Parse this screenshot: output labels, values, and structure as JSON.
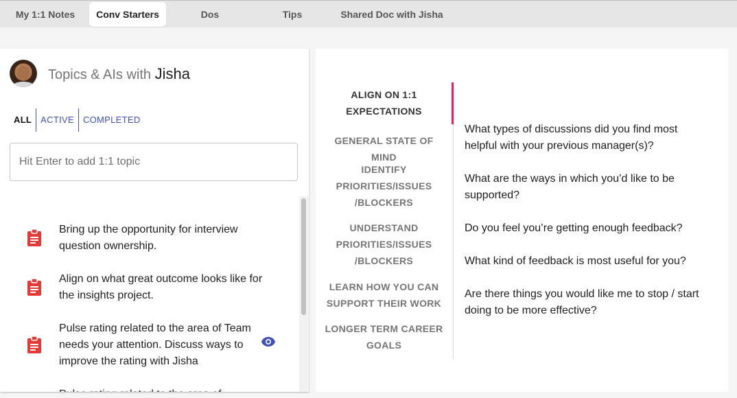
{
  "tabs": [
    {
      "label": "My 1:1 Notes",
      "active": false
    },
    {
      "label": "Conv Starters",
      "active": true
    },
    {
      "label": "Dos",
      "active": false
    },
    {
      "label": "Tips",
      "active": false
    },
    {
      "label": "Shared Doc with Jisha",
      "active": false
    }
  ],
  "left_panel": {
    "title_prefix": "Topics & AIs with",
    "person_name": "Jisha",
    "filters": [
      "ALL",
      "ACTIVE",
      "COMPLETED"
    ],
    "input_placeholder": "Hit Enter to add 1:1 topic",
    "topics": [
      {
        "text": "Bring up the opportunity for interview question ownership.",
        "icon": "clipboard-icon"
      },
      {
        "text": "Align on what great outcome looks like for the insights project.",
        "icon": "clipboard-icon"
      },
      {
        "text": "Pulse rating related to the area of Team needs your attention. Discuss ways to improve the rating with Jisha",
        "icon": "clipboard-icon",
        "has_eye": true
      },
      {
        "text": "Pulse rating related to the area of",
        "icon": "clipboard-icon"
      }
    ]
  },
  "right_panel": {
    "menu": [
      {
        "label": "ALIGN ON 1:1 EXPECTATIONS",
        "active": true
      },
      {
        "label": "GENERAL STATE OF MIND",
        "active": false
      },
      {
        "label": "IDENTIFY PRIORITIES/ISSUES /BLOCKERS",
        "active": false
      },
      {
        "label": "UNDERSTAND PRIORITIES/ISSUES /BLOCKERS",
        "active": false
      },
      {
        "label": "LEARN HOW YOU CAN SUPPORT THEIR WORK",
        "active": false
      },
      {
        "label": "LONGER TERM CAREER GOALS",
        "active": false
      }
    ],
    "questions": [
      "What types of discussions did you find most helpful with your previous manager(s)?",
      "What are the ways in which you’d like to be supported?",
      "Do you feel you’re getting enough feedback?",
      "What kind of feedback is most useful for you?",
      "Are there things you would like me to stop / start doing to be more effective?"
    ]
  },
  "colors": {
    "accent": "#3f51b5",
    "active_marker": "#e91e63",
    "clipboard": "#e53935"
  }
}
